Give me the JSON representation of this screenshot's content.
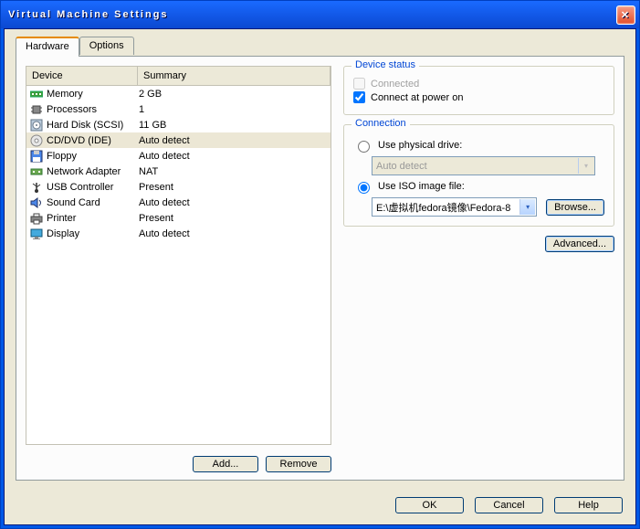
{
  "window": {
    "title": "Virtual Machine Settings"
  },
  "tabs": {
    "hardware": "Hardware",
    "options": "Options",
    "active": "hardware"
  },
  "list": {
    "device_col": "Device",
    "summary_col": "Summary",
    "items": [
      {
        "icon": "memory-icon",
        "name": "Memory",
        "summary": "2 GB"
      },
      {
        "icon": "cpu-icon",
        "name": "Processors",
        "summary": "1"
      },
      {
        "icon": "disk-icon",
        "name": "Hard Disk (SCSI)",
        "summary": "11 GB"
      },
      {
        "icon": "cd-icon",
        "name": "CD/DVD (IDE)",
        "summary": "Auto detect",
        "selected": true
      },
      {
        "icon": "floppy-icon",
        "name": "Floppy",
        "summary": "Auto detect"
      },
      {
        "icon": "net-icon",
        "name": "Network Adapter",
        "summary": "NAT"
      },
      {
        "icon": "usb-icon",
        "name": "USB Controller",
        "summary": "Present"
      },
      {
        "icon": "sound-icon",
        "name": "Sound Card",
        "summary": "Auto detect"
      },
      {
        "icon": "printer-icon",
        "name": "Printer",
        "summary": "Present"
      },
      {
        "icon": "display-icon",
        "name": "Display",
        "summary": "Auto detect"
      }
    ]
  },
  "buttons": {
    "add": "Add...",
    "remove": "Remove",
    "browse": "Browse...",
    "advanced": "Advanced...",
    "ok": "OK",
    "cancel": "Cancel",
    "help": "Help"
  },
  "device_status": {
    "title": "Device status",
    "connected": "Connected",
    "connected_checked": false,
    "connected_enabled": false,
    "poweron": "Connect at power on",
    "poweron_checked": true
  },
  "connection": {
    "title": "Connection",
    "physical": "Use physical drive:",
    "physical_value": "Auto detect",
    "iso": "Use ISO image file:",
    "iso_value": "E:\\虚拟机fedora镜像\\Fedora-8",
    "selected": "iso"
  }
}
